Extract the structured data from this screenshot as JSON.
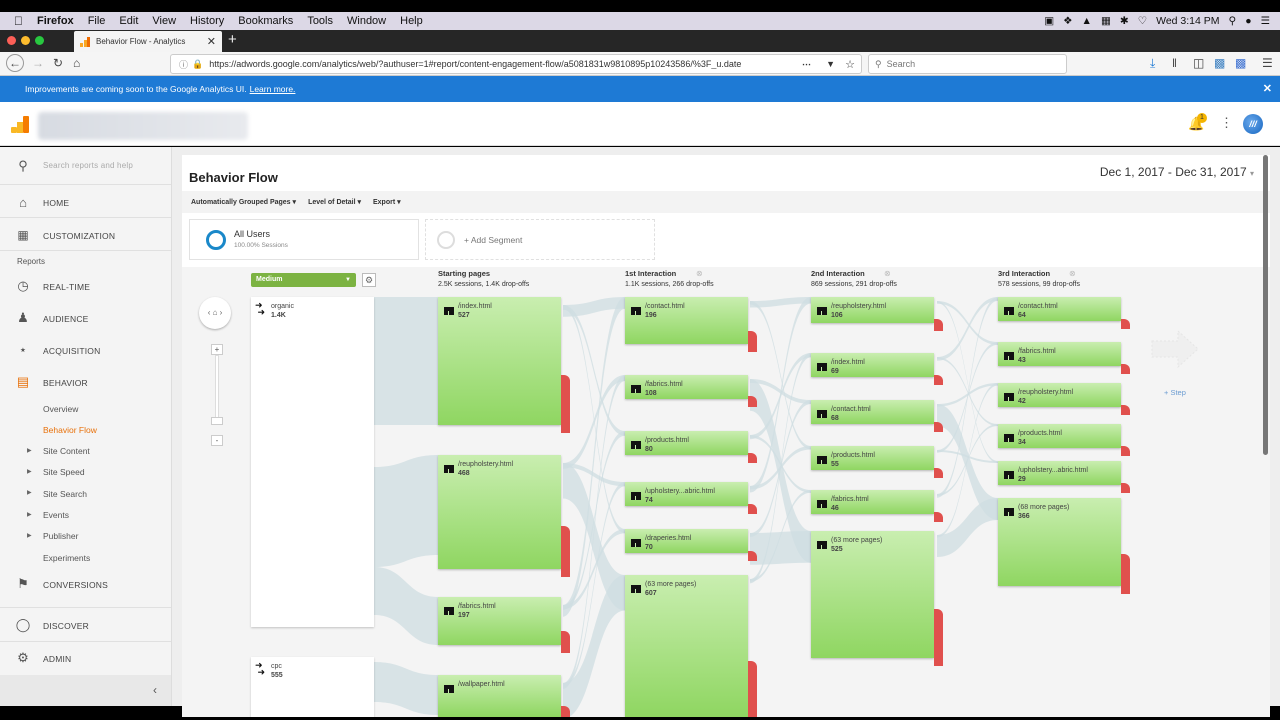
{
  "macos": {
    "app": "Firefox",
    "menu": [
      "File",
      "Edit",
      "View",
      "History",
      "Bookmarks",
      "Tools",
      "Window",
      "Help"
    ],
    "clock": "Wed 3:14 PM"
  },
  "browser": {
    "tab_title": "Behavior Flow - Analytics",
    "url": "https://adwords.google.com/analytics/web/?authuser=1#report/content-engagement-flow/a5081831w9810895p10243586/%3F_u.date",
    "search_placeholder": "Search"
  },
  "banner": {
    "text": "Improvements are coming soon to the Google Analytics UI.",
    "link": "Learn more."
  },
  "header": {
    "notification_count": "1"
  },
  "sidebar": {
    "search_placeholder": "Search reports and help",
    "home": "HOME",
    "customization": "CUSTOMIZATION",
    "reports_label": "Reports",
    "realtime": "REAL-TIME",
    "audience": "AUDIENCE",
    "acquisition": "ACQUISITION",
    "behavior": "BEHAVIOR",
    "behavior_items": [
      "Overview",
      "Behavior Flow",
      "Site Content",
      "Site Speed",
      "Site Search",
      "Events",
      "Publisher",
      "Experiments"
    ],
    "conversions": "CONVERSIONS",
    "discover": "DISCOVER",
    "admin": "ADMIN"
  },
  "report": {
    "title": "Behavior Flow",
    "date_range": "Dec 1, 2017 - Dec 31, 2017",
    "toolbar": [
      "Automatically Grouped Pages",
      "Level of Detail",
      "Export"
    ],
    "segment_name": "All Users",
    "segment_sub": "100.00% Sessions",
    "add_segment": "+ Add Segment",
    "dimension_select": "Medium",
    "add_step": "+ Step",
    "accent_green": "#7cb342",
    "dropoff_red": "#e0504d"
  },
  "flow": {
    "sources": [
      {
        "name": "organic",
        "value": "1.4K"
      },
      {
        "name": "cpc",
        "value": "555"
      }
    ],
    "columns": [
      {
        "title": "Starting pages",
        "summary": "2.5K sessions, 1.4K drop-offs",
        "nodes": [
          {
            "name": "/index.html",
            "value": "527"
          },
          {
            "name": "/reupholstery.html",
            "value": "468"
          },
          {
            "name": "/fabrics.html",
            "value": "197"
          },
          {
            "name": "/wallpaper.html",
            "value": ""
          }
        ]
      },
      {
        "title": "1st Interaction",
        "summary": "1.1K sessions, 266 drop-offs",
        "nodes": [
          {
            "name": "/contact.html",
            "value": "196"
          },
          {
            "name": "/fabrics.html",
            "value": "108"
          },
          {
            "name": "/products.html",
            "value": "80"
          },
          {
            "name": "/upholstery...abric.html",
            "value": "74"
          },
          {
            "name": "/draperies.html",
            "value": "70"
          },
          {
            "name": "(63 more pages)",
            "value": "607"
          }
        ]
      },
      {
        "title": "2nd Interaction",
        "summary": "869 sessions, 291 drop-offs",
        "nodes": [
          {
            "name": "/reupholstery.html",
            "value": "106"
          },
          {
            "name": "/index.html",
            "value": "69"
          },
          {
            "name": "/contact.html",
            "value": "68"
          },
          {
            "name": "/products.html",
            "value": "55"
          },
          {
            "name": "/fabrics.html",
            "value": "46"
          },
          {
            "name": "(63 more pages)",
            "value": "525"
          }
        ]
      },
      {
        "title": "3rd Interaction",
        "summary": "578 sessions, 99 drop-offs",
        "nodes": [
          {
            "name": "/contact.html",
            "value": "64"
          },
          {
            "name": "/fabrics.html",
            "value": "43"
          },
          {
            "name": "/reupholstery.html",
            "value": "42"
          },
          {
            "name": "/products.html",
            "value": "34"
          },
          {
            "name": "/upholstery...abric.html",
            "value": "29"
          },
          {
            "name": "(68 more pages)",
            "value": "366"
          }
        ]
      }
    ]
  }
}
